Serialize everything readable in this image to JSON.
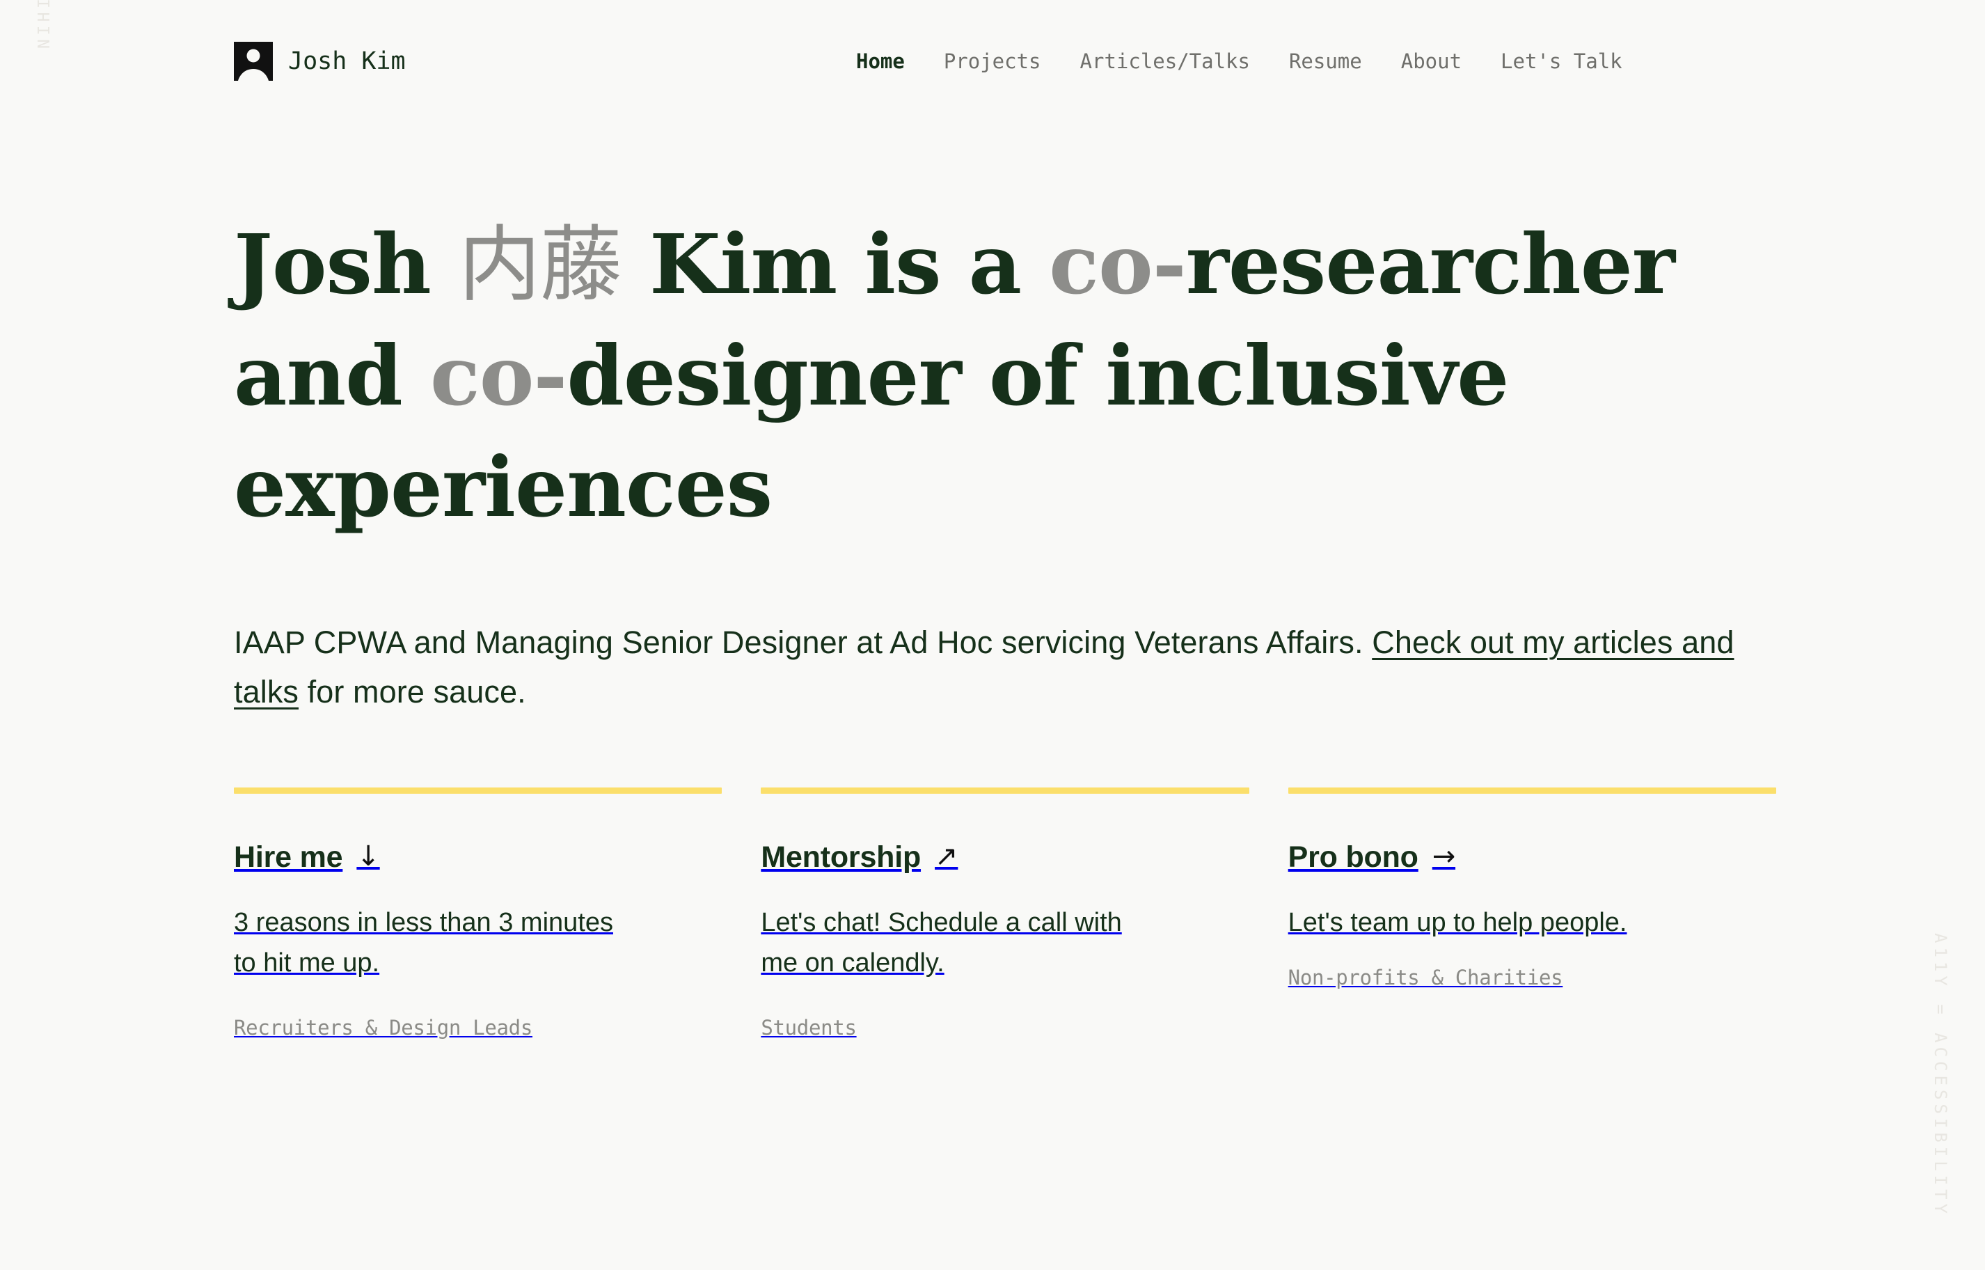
{
  "theme": {
    "background": "#f9f9f7",
    "primary_green": "#16301a",
    "muted_gray": "#8d8d8a",
    "accent_yellow": "#fbdf6b",
    "watermark_gray": "#e8e6e1"
  },
  "watermarks": {
    "left": "NIHIL DE NOBIS, SINE NOBIS",
    "right": "A11Y = ACCESSIBILITY"
  },
  "header": {
    "logo_icon": "avatar-icon",
    "brand_name": "Josh Kim",
    "nav": [
      {
        "label": "Home",
        "active": true
      },
      {
        "label": "Projects",
        "active": false
      },
      {
        "label": "Articles/Talks",
        "active": false
      },
      {
        "label": "Resume",
        "active": false
      },
      {
        "label": "About",
        "active": false
      },
      {
        "label": "Let's Talk",
        "active": false
      }
    ]
  },
  "hero": {
    "heading_parts": {
      "p1": "Josh ",
      "jp": "内藤",
      "p2": " Kim is a ",
      "co1": "co-",
      "p3": "researcher and ",
      "co2": "co-",
      "p4": "designer of inclusive experiences"
    },
    "lede": {
      "before": "IAAP CPWA and Managing Senior Designer at Ad Hoc servicing Veterans Affairs. ",
      "link": "Check out my articles and talks",
      "after": " for more sauce."
    }
  },
  "cards": [
    {
      "title": "Hire me",
      "arrow_glyph": "↓",
      "arrow_icon": "arrow-down-icon",
      "description": "3 reasons in less than 3 minutes to hit me up.",
      "audience": "Recruiters & Design Leads"
    },
    {
      "title": "Mentorship",
      "arrow_glyph": "↗",
      "arrow_icon": "arrow-up-right-icon",
      "description": "Let's chat! Schedule a call with me on calendly.",
      "audience": "Students"
    },
    {
      "title": "Pro bono",
      "arrow_glyph": "→",
      "arrow_icon": "arrow-right-icon",
      "description": "Let's team up to help people.",
      "audience": "Non-profits & Charities"
    }
  ]
}
